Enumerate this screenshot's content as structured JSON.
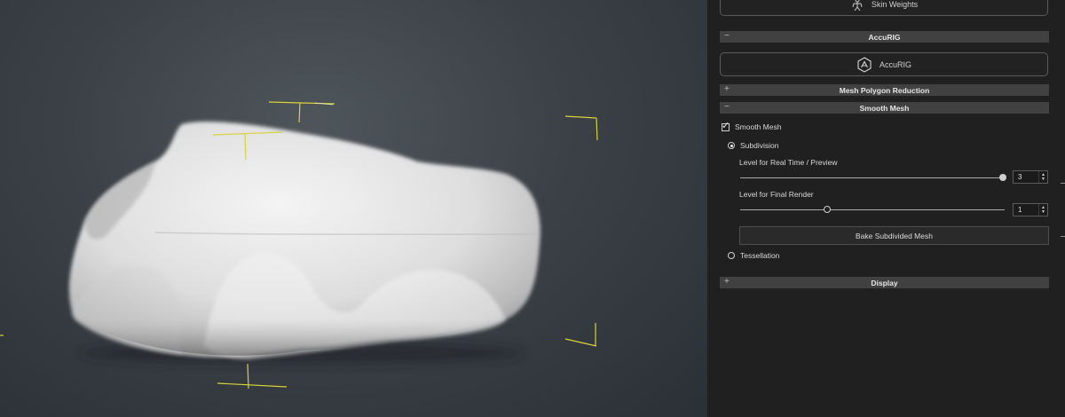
{
  "viewport": {
    "background": "#3f454b",
    "gizmo_color": "#d6d23a",
    "mesh_color": "#e8e8e8"
  },
  "panel": {
    "skin_weights": {
      "label": "Skin Weights",
      "icon": "skin-weights-icon"
    },
    "accurig_header": {
      "toggle": "−",
      "title": "AccuRIG"
    },
    "accurig_button": {
      "label": "AccuRIG",
      "icon": "accurig-icon"
    },
    "mesh_polygon_header": {
      "toggle": "+",
      "title": "Mesh Polygon Reduction"
    },
    "smooth_mesh_header": {
      "toggle": "−",
      "title": "Smooth Mesh"
    },
    "smooth_mesh_checkbox": {
      "label": "Smooth Mesh",
      "checked": true,
      "mark": "✓"
    },
    "subdivision": {
      "label": "Subdivision",
      "selected": true
    },
    "realtime_level": {
      "label": "Level for Real Time / Preview",
      "value": "3",
      "fraction": 1.0
    },
    "final_render_level": {
      "label": "Level for Final Render",
      "value": "1",
      "fraction": 0.33
    },
    "bake_button": {
      "label": "Bake Subdivided Mesh"
    },
    "tessellation": {
      "label": "Tessellation",
      "selected": false
    },
    "display_header": {
      "toggle": "+",
      "title": "Display"
    },
    "spin_up": "▲",
    "spin_down": "▼"
  }
}
